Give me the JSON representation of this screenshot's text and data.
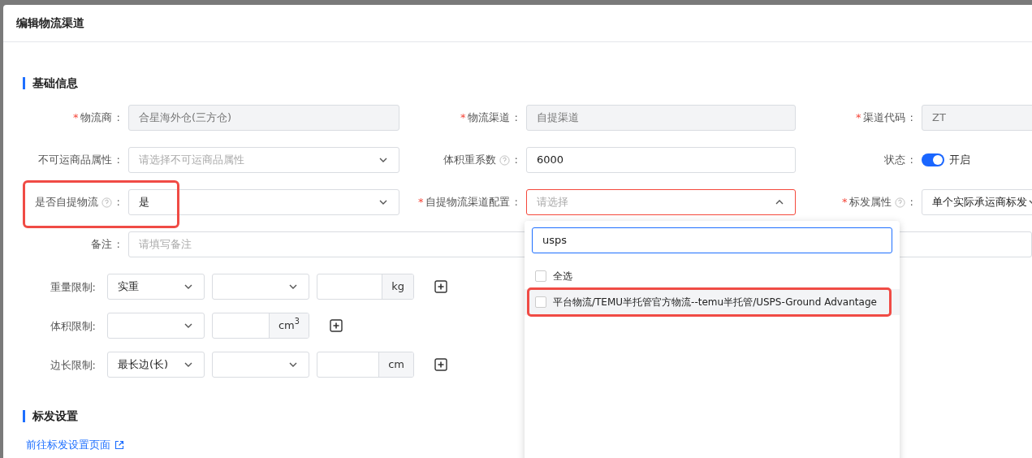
{
  "dialog": {
    "title": "编辑物流渠道"
  },
  "basic_info": {
    "heading": "基础信息",
    "fields": [
      {
        "label": "物流商",
        "required_mark": "*",
        "colon": ":",
        "kind": "input",
        "value": "合星海外仓(三方仓)",
        "disabled": true
      },
      {
        "label": "物流渠道",
        "required_mark": "*",
        "colon": ":",
        "kind": "input",
        "value": "自提渠道",
        "disabled": true
      },
      {
        "label": "渠道代码",
        "required_mark": "*",
        "colon": ":",
        "kind": "input",
        "value": "ZT",
        "disabled": true
      },
      {
        "label": "不可运商品属性",
        "colon": ":",
        "kind": "select",
        "placeholder": "请选择不可运商品属性"
      },
      {
        "label": "体积重系数",
        "help": true,
        "colon": ":",
        "kind": "input",
        "value": "6000"
      },
      {
        "label": "状态",
        "colon": ":",
        "kind": "switch",
        "on": true,
        "value": "开启"
      },
      {
        "label": "是否自提物流",
        "help": true,
        "colon": ":",
        "kind": "select",
        "value": "是",
        "highlighted": true
      },
      {
        "label": "自提物流渠道配置",
        "required_mark": "*",
        "colon": ":",
        "kind": "select",
        "placeholder": "请选择",
        "open": true,
        "error": true
      },
      {
        "label": "标发属性",
        "required_mark": "*",
        "help": true,
        "colon": ":",
        "kind": "select",
        "value": "单个实际承运商标发"
      },
      {
        "label": "备注",
        "colon": ":",
        "kind": "wide",
        "placeholder": "请填写备注"
      }
    ],
    "limits": [
      {
        "label": "重量限制:",
        "controls": [
          {
            "kind": "select",
            "value": "实重"
          },
          {
            "kind": "select"
          },
          {
            "kind": "input",
            "suffix": "kg"
          }
        ]
      },
      {
        "label": "体积限制:",
        "controls": [
          {
            "kind": "select"
          },
          {
            "kind": "input",
            "suffix": "cm$^{3}$"
          }
        ]
      },
      {
        "label": "边长限制:",
        "controls": [
          {
            "kind": "select",
            "value": "最长边(长)"
          },
          {
            "kind": "select"
          },
          {
            "kind": "input",
            "suffix": "cm"
          }
        ]
      }
    ]
  },
  "dropdown": {
    "search_value": "usps",
    "options": [
      {
        "label": "全选",
        "checked": false,
        "highlighted": false
      },
      {
        "label": "平台物流/TEMU半托管官方物流--temu半托管/USPS-Ground Advantage",
        "checked": false,
        "highlighted": true
      }
    ]
  },
  "label_settings": {
    "heading": "标发设置",
    "link": "前往标发设置页面"
  }
}
